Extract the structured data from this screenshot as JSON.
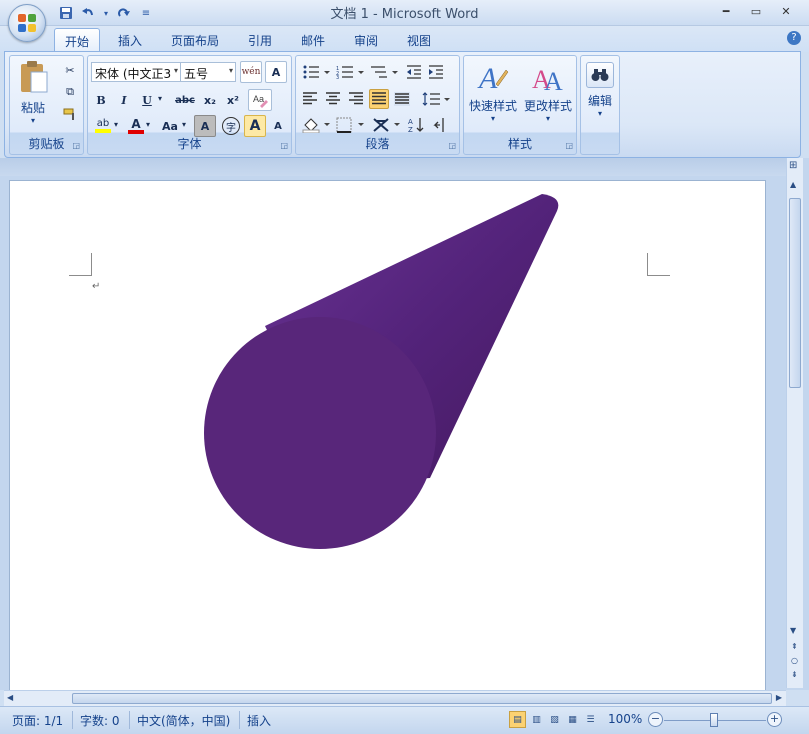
{
  "window": {
    "title": "文档 1 - Microsoft Word"
  },
  "quick_access": {
    "icons": [
      "save-icon",
      "undo-icon",
      "redo-icon",
      "customize-icon"
    ]
  },
  "tabs": [
    {
      "label": "开始",
      "active": true
    },
    {
      "label": "插入"
    },
    {
      "label": "页面布局"
    },
    {
      "label": "引用"
    },
    {
      "label": "邮件"
    },
    {
      "label": "审阅"
    },
    {
      "label": "视图"
    }
  ],
  "ribbon": {
    "clipboard": {
      "label": "剪贴板",
      "paste_label": "粘贴"
    },
    "font": {
      "label": "字体",
      "font_name": "宋体 (中文正3",
      "font_size": "五号",
      "phonetic": "wén\n变",
      "bold": "B",
      "italic": "I",
      "underline": "U",
      "strike": "abc",
      "subscript": "x₂",
      "superscript": "x²",
      "highlight": "ab",
      "font_color": "A",
      "case": "Aa",
      "shade": "A",
      "enclose": "字",
      "grow": "A",
      "shrink": "A",
      "border_char": "A"
    },
    "paragraph": {
      "label": "段落"
    },
    "styles": {
      "label": "样式",
      "quick_styles": "快速样式",
      "change_styles": "更改样式"
    },
    "editing": {
      "label": "编辑"
    }
  },
  "document": {
    "paragraph_mark": "↵",
    "shape_colors": {
      "face": "#58267a",
      "body": "#4c206a",
      "body_light": "#6a3394"
    }
  },
  "status": {
    "page": "页面: 1/1",
    "words": "字数: 0",
    "language": "中文(简体，中国)",
    "mode": "插入",
    "zoom": "100%"
  }
}
